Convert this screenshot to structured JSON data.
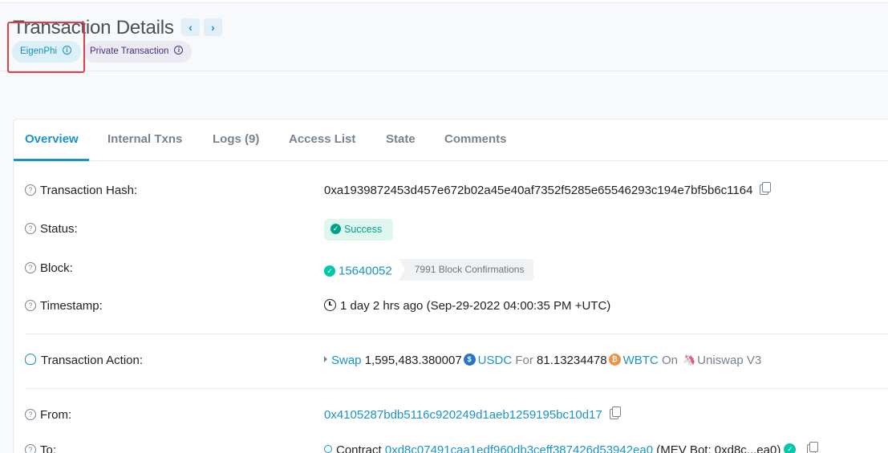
{
  "header": {
    "title": "Transaction Details",
    "prev_icon": "‹",
    "next_icon": "›",
    "badges": {
      "eigenphi": "EigenPhi",
      "private": "Private Transaction",
      "info_icon": "i"
    }
  },
  "tabs": [
    {
      "label": "Overview"
    },
    {
      "label": "Internal Txns"
    },
    {
      "label": "Logs (9)"
    },
    {
      "label": "Access List"
    },
    {
      "label": "State"
    },
    {
      "label": "Comments"
    }
  ],
  "overview": {
    "tx_hash": {
      "label": "Transaction Hash:",
      "value": "0xa1939872453d457e672b02a45e40af7352f5285e65546293c194e7bf5b6c1164"
    },
    "status": {
      "label": "Status:",
      "value": "Success"
    },
    "block": {
      "label": "Block:",
      "number": "15640052",
      "confirmations": "7991 Block Confirmations"
    },
    "timestamp": {
      "label": "Timestamp:",
      "value": "1 day 2 hrs ago (Sep-29-2022 04:00:35 PM +UTC)"
    },
    "action": {
      "label": "Transaction Action:",
      "verb": "Swap",
      "amount_in": "1,595,483.380007",
      "token_in": "USDC",
      "for": "For",
      "amount_out": "81.13234478",
      "token_out": "WBTC",
      "on": "On",
      "dex": "Uniswap V3"
    },
    "from": {
      "label": "From:",
      "value": "0x4105287bdb5116c920249d1aeb1259195bc10d17"
    },
    "to": {
      "label": "To:",
      "prefix": "Contract",
      "address": "0xd8c07491caa1edf960db3ceff387426d53942ea0",
      "name": "(MEV Bot: 0xd8c...ea0)"
    }
  },
  "icons": {
    "help": "?",
    "check": "✓",
    "usdc": "$",
    "wbtc": "₿",
    "uni": "🦄"
  }
}
